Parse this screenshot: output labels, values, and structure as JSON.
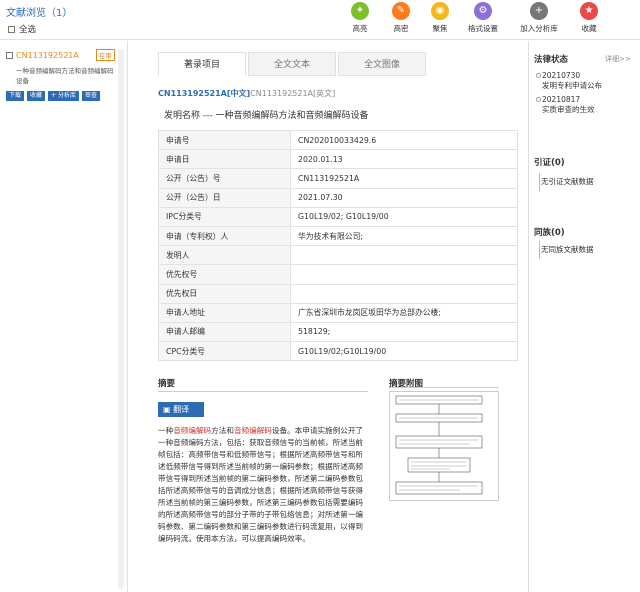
{
  "header": {
    "title": "文献浏览（1）",
    "select_all": "全选",
    "tools": [
      {
        "label": "高亮",
        "icon": "highlight-icon",
        "color": "#7cc02a",
        "glyph": "✦"
      },
      {
        "label": "高密",
        "icon": "dense-icon",
        "color": "#ff7a1a",
        "glyph": "✎"
      },
      {
        "label": "聚焦",
        "icon": "focus-icon",
        "color": "#f4b71c",
        "glyph": "◉"
      },
      {
        "label": "格式设置",
        "icon": "format-settings-icon",
        "color": "#8e6fd8",
        "glyph": "⚙"
      },
      {
        "label": "加入分析库",
        "icon": "add-analysis-icon",
        "color": "#777777",
        "glyph": "+"
      },
      {
        "label": "收藏",
        "icon": "favorite-icon",
        "color": "#e84a4a",
        "glyph": "★"
      }
    ]
  },
  "left_list": {
    "items": [
      {
        "code": "CN113192521A",
        "badge": "在审",
        "desc": "一种音频编解码方法和音频编解码设备",
        "buttons": [
          "下载",
          "收藏",
          "+ 分析库",
          "审查"
        ]
      }
    ]
  },
  "tabs": [
    "著录项目",
    "全文文本",
    "全文图像"
  ],
  "doc": {
    "code_cn": "CN113192521A[中文]",
    "code_en": "CN113192521A[英文]",
    "invention_label": "发明名称 ---",
    "invention_name": "一种音频编解码方法和音频编解码设备",
    "fields": [
      {
        "k": "申请号",
        "v": "CN202010033429.6"
      },
      {
        "k": "申请日",
        "v": "2020.01.13"
      },
      {
        "k": "公开（公告）号",
        "v": "CN113192521A"
      },
      {
        "k": "公开（公告）日",
        "v": "2021.07.30"
      },
      {
        "k": "IPC分类号",
        "v": "G10L19/02; G10L19/00"
      },
      {
        "k": "申请（专利权）人",
        "v": "华为技术有限公司;"
      },
      {
        "k": "发明人",
        "v": ""
      },
      {
        "k": "优先权号",
        "v": ""
      },
      {
        "k": "优先权日",
        "v": ""
      },
      {
        "k": "申请人地址",
        "v": "广东省深圳市龙岗区坂田华为总部办公楼;"
      },
      {
        "k": "申请人邮编",
        "v": "518129;"
      },
      {
        "k": "CPC分类号",
        "v": "G10L19/02;G10L19/00"
      }
    ],
    "abstract_title": "摘要",
    "translate_label": "翻译",
    "abstract_pre": "一种",
    "abstract_hl1": "音频编解码",
    "abstract_mid": "方法和",
    "abstract_hl2": "音频编解码",
    "abstract_post": "设备。本申请实施例公开了一种音频编码方法，包括：获取音频信号的当前帧，所述当前帧包括：高频带信号和低频带信号；根据所述高频带信号和所述低频带信号得到所述当前帧的第一编码参数；根据所述高频带信号得到所述当前帧的第二编码参数，所述第二编码参数包括所述高频带信号的音调成分信息；根据所述高频带信号获得所述当前帧的第三编码参数，所述第三编码参数包括需要编码的所述高频带信号的部分子带的子带包络信息；对所述第一编码参数、第二编码参数和第三编码参数进行码流复用，以得到编码码流。使用本方法，可以提高编码效率。",
    "figure_title": "摘要附图"
  },
  "right": {
    "legal_title": "法律状态",
    "detail_link": "详细>>",
    "legal_events": [
      {
        "date": "20210730",
        "text": "发明专利申请公布"
      },
      {
        "date": "20210817",
        "text": "实质审查的生效"
      }
    ],
    "cite_title": "引证(0)",
    "cite_empty": "无引证文献数据",
    "family_title": "同族(0)",
    "family_empty": "无同族文献数据"
  }
}
